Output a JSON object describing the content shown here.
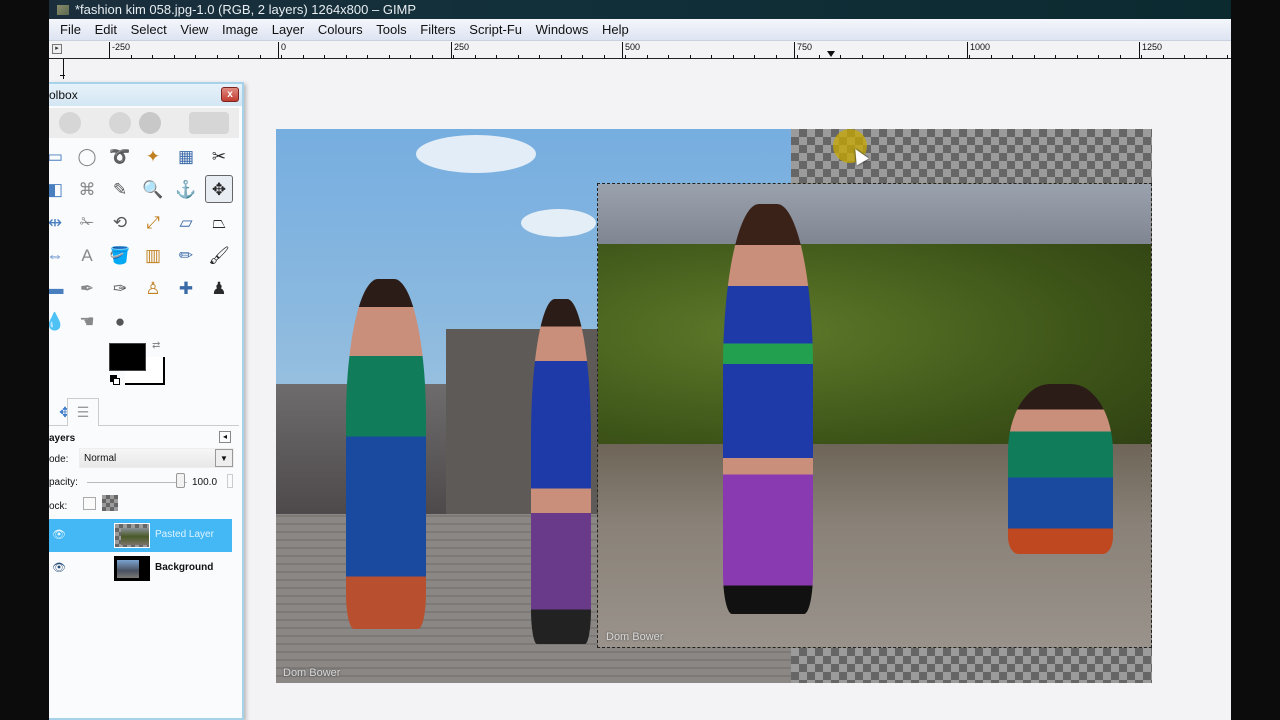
{
  "window": {
    "title": "*fashion kim 058.jpg-1.0 (RGB, 2 layers) 1264x800 – GIMP"
  },
  "menubar": {
    "items": [
      "File",
      "Edit",
      "Select",
      "View",
      "Image",
      "Layer",
      "Colours",
      "Tools",
      "Filters",
      "Script-Fu",
      "Windows",
      "Help"
    ]
  },
  "ruler": {
    "labels": [
      "-250",
      "0",
      "250",
      "500",
      "750",
      "1000",
      "1250"
    ]
  },
  "canvas": {
    "watermark_background": "Dom Bower",
    "watermark_pasted": "Dom Bower",
    "selection_color": "#d8c22a"
  },
  "toolbox": {
    "title": "Toolbox",
    "title_visible": "olbox",
    "close_label": "x",
    "tools": [
      {
        "name": "rect-select",
        "glyph": "▭"
      },
      {
        "name": "ellipse-select",
        "glyph": "◯"
      },
      {
        "name": "free-select",
        "glyph": "➰"
      },
      {
        "name": "fuzzy-select",
        "glyph": "✦"
      },
      {
        "name": "select-by-color",
        "glyph": "▦"
      },
      {
        "name": "scissors-select",
        "glyph": "✂"
      },
      {
        "name": "foreground-select",
        "glyph": "◧"
      },
      {
        "name": "paths",
        "glyph": "⌘"
      },
      {
        "name": "color-picker",
        "glyph": "✎"
      },
      {
        "name": "zoom",
        "glyph": "🔍"
      },
      {
        "name": "measure",
        "glyph": "⚓"
      },
      {
        "name": "move",
        "glyph": "✥"
      },
      {
        "name": "align",
        "glyph": "⇹"
      },
      {
        "name": "crop",
        "glyph": "✁"
      },
      {
        "name": "rotate",
        "glyph": "⟲"
      },
      {
        "name": "scale",
        "glyph": "⤢"
      },
      {
        "name": "shear",
        "glyph": "▱"
      },
      {
        "name": "perspective",
        "glyph": "⏢"
      },
      {
        "name": "flip",
        "glyph": "⇔"
      },
      {
        "name": "text",
        "glyph": "A"
      },
      {
        "name": "bucket-fill",
        "glyph": "🪣"
      },
      {
        "name": "blend",
        "glyph": "▥"
      },
      {
        "name": "pencil",
        "glyph": "✏"
      },
      {
        "name": "paintbrush",
        "glyph": "🖌"
      },
      {
        "name": "eraser",
        "glyph": "▬"
      },
      {
        "name": "airbrush",
        "glyph": "✒"
      },
      {
        "name": "ink",
        "glyph": "✑"
      },
      {
        "name": "clone",
        "glyph": "♙"
      },
      {
        "name": "heal",
        "glyph": "✚"
      },
      {
        "name": "perspective-clone",
        "glyph": "♟"
      },
      {
        "name": "blur-sharpen",
        "glyph": "💧"
      },
      {
        "name": "smudge",
        "glyph": "☚"
      },
      {
        "name": "dodge-burn",
        "glyph": "●"
      }
    ],
    "active_tool": "move",
    "foreground_color": "#000000",
    "background_color": "#ffffff"
  },
  "layers": {
    "title": "Layers",
    "title_visible": "ayers",
    "mode_label": "Mode:",
    "mode_label_visible": "ode:",
    "mode_value": "Normal",
    "opacity_label": "Opacity:",
    "opacity_label_visible": "pacity:",
    "opacity_value": "100.0",
    "opacity_percent": 100,
    "lock_label": "Lock:",
    "lock_label_visible": "ock:",
    "items": [
      {
        "name": "Pasted Layer",
        "visible": true,
        "selected": true
      },
      {
        "name": "Background",
        "visible": true,
        "selected": false
      }
    ]
  }
}
